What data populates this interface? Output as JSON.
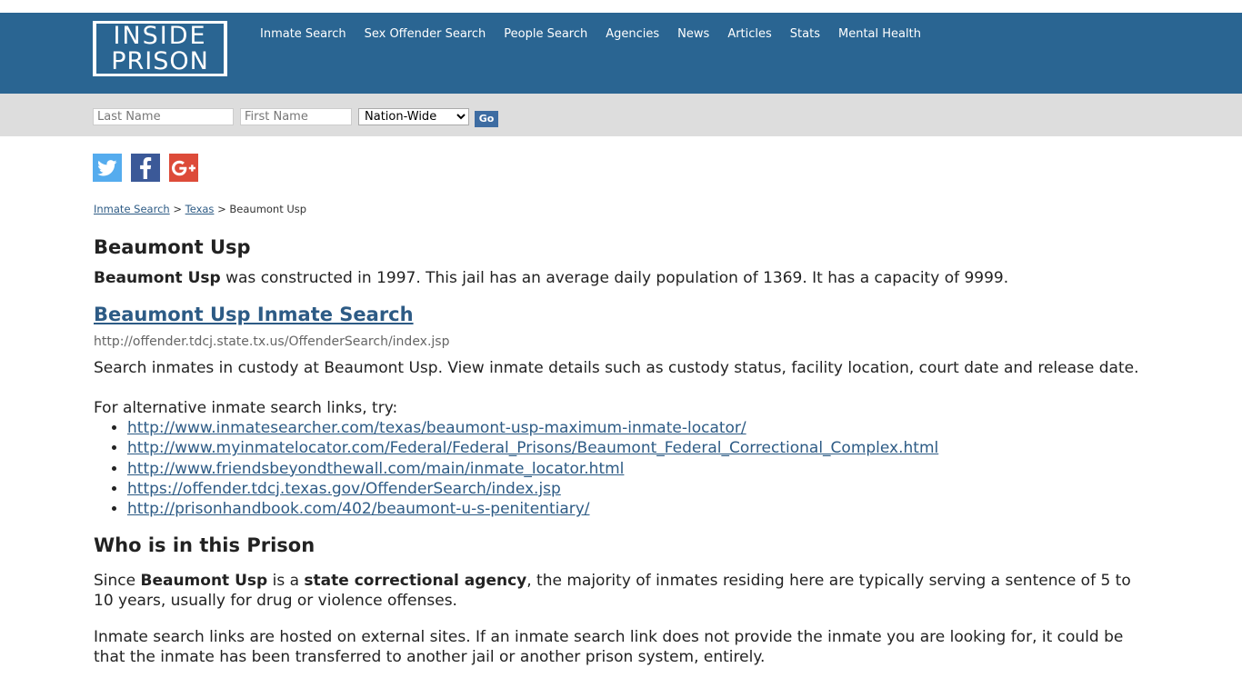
{
  "header": {
    "logo": {
      "line1": "INSIDE",
      "line2": "PRISON"
    },
    "nav": [
      "Inmate Search",
      "Sex Offender Search",
      "People Search",
      "Agencies",
      "News",
      "Articles",
      "Stats",
      "Mental Health"
    ]
  },
  "search": {
    "last_name_placeholder": "Last Name",
    "first_name_placeholder": "First Name",
    "scope_selected": "Nation-Wide",
    "go_label": "Go"
  },
  "social": {
    "icons": [
      "twitter-icon",
      "facebook-icon",
      "google-plus-icon"
    ],
    "colors": {
      "twitter": "#55acee",
      "facebook": "#3b5998",
      "google_plus": "#dd4b39"
    }
  },
  "breadcrumb": {
    "items": [
      "Inmate Search",
      "Texas"
    ],
    "separator": ">",
    "current": "Beaumont Usp"
  },
  "page": {
    "title": "Beaumont Usp",
    "intro_bold": "Beaumont Usp",
    "intro_rest": " was constructed in 1997. This jail has an average daily population of 1369. It has a capacity of 9999.",
    "search_heading": "Beaumont Usp Inmate Search",
    "search_url": "http://offender.tdcj.state.tx.us/OffenderSearch/index.jsp",
    "search_desc": "Search inmates in custody at Beaumont Usp. View inmate details such as custody status, facility location, court date and release date.",
    "alt_intro": "For alternative inmate search links, try:",
    "alt_links": [
      "http://www.inmatesearcher.com/texas/beaumont-usp-maximum-inmate-locator/",
      "http://www.myinmatelocator.com/Federal/Federal_Prisons/Beaumont_Federal_Correctional_Complex.html",
      "http://www.friendsbeyondthewall.com/main/inmate_locator.html",
      "https://offender.tdcj.texas.gov/OffenderSearch/index.jsp",
      "http://prisonhandbook.com/402/beaumont-u-s-penitentiary/"
    ],
    "who_heading": "Who is in this Prison",
    "since_1": "Since ",
    "since_bold1": "Beaumont Usp",
    "since_2": " is a ",
    "since_bold2": "state correctional agency",
    "since_3": ", the majority of inmates residing here are typically serving a sentence of 5 to 10 years, usually for drug or violence offenses.",
    "note": "Inmate search links are hosted on external sites. If an inmate search link does not provide the inmate you are looking for, it could be that the inmate has been transferred to another jail or another prison system, entirely."
  },
  "colors": {
    "header_bg": "#2a6592",
    "searchbar_bg": "#dddddd",
    "link": "#2d5b85",
    "go_button": "#3d6ca2"
  }
}
